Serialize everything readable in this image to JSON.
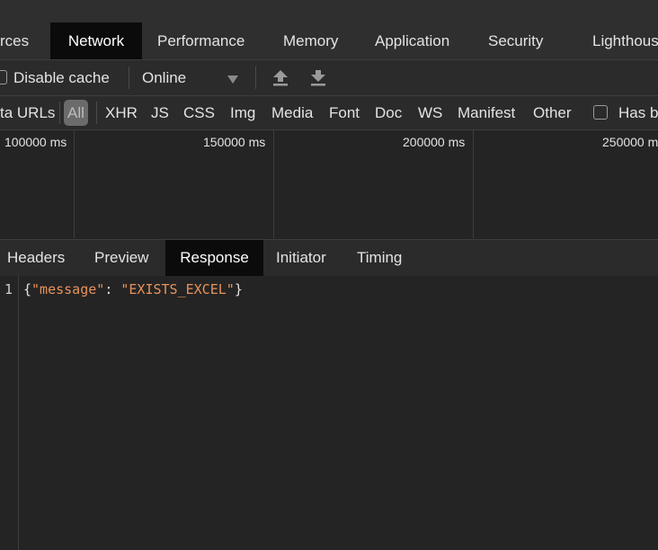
{
  "main_tabs": [
    "rces",
    "Network",
    "Performance",
    "Memory",
    "Application",
    "Security",
    "Lighthous"
  ],
  "active_main_tab": "Network",
  "toolbar": {
    "disable_cache_label": "Disable cache",
    "throttle_value": "Online",
    "disable_cache_checked": false
  },
  "filters": {
    "data_urls_label": "ta URLs",
    "types": [
      "All",
      "XHR",
      "JS",
      "CSS",
      "Img",
      "Media",
      "Font",
      "Doc",
      "WS",
      "Manifest",
      "Other"
    ],
    "active_type": "All",
    "has_blocked_label": "Has b"
  },
  "timeline": {
    "ticks": [
      "100000 ms",
      "150000 ms",
      "200000 ms",
      "250000 m"
    ]
  },
  "detail_tabs": [
    "Headers",
    "Preview",
    "Response",
    "Initiator",
    "Timing"
  ],
  "active_detail_tab": "Response",
  "response": {
    "line_number": "1",
    "open_brace": "{",
    "key": "\"message\"",
    "colon": ": ",
    "value": "\"EXISTS_EXCEL\"",
    "close_brace": "}"
  },
  "colors": {
    "background": "#242424",
    "active_tab": "#0b0b0b",
    "json_key": "#e8925a",
    "json_string": "#e8925a",
    "text": "#e3e3e3"
  }
}
